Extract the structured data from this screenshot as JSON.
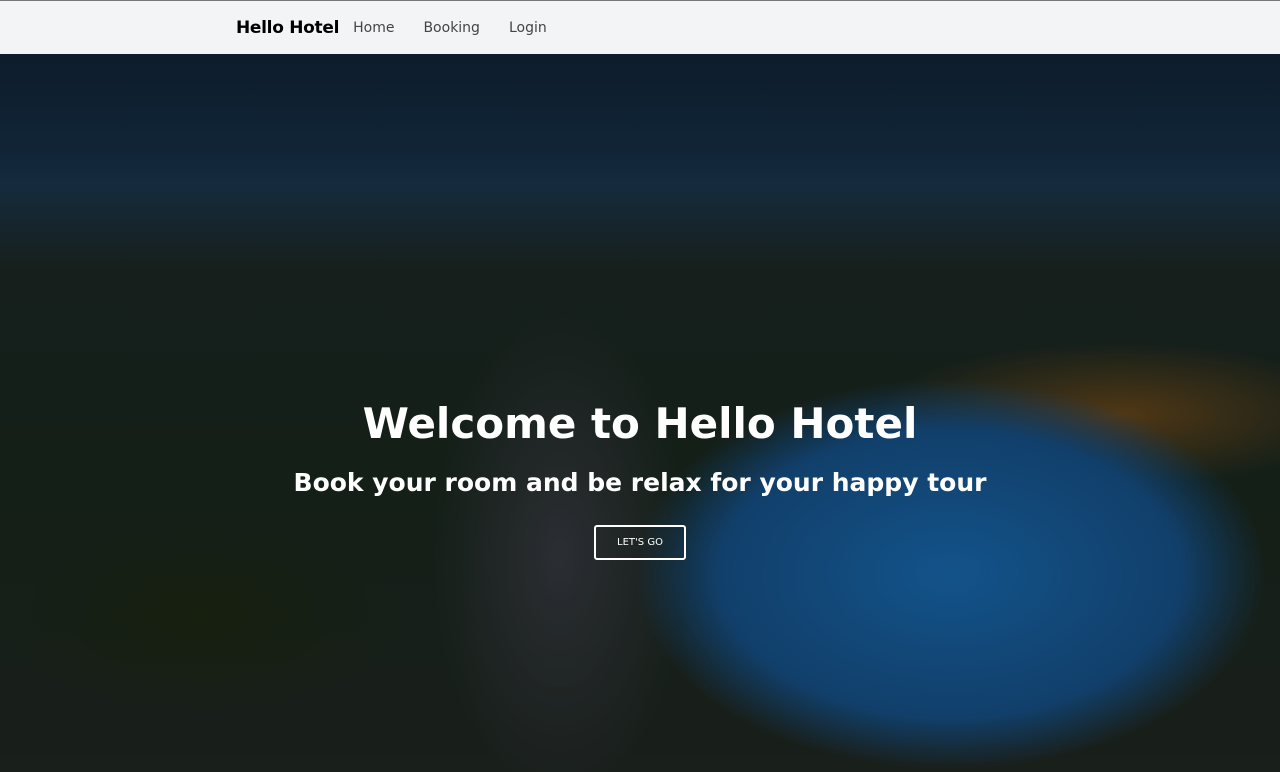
{
  "nav": {
    "brand": "Hello Hotel",
    "items": [
      {
        "label": "Home"
      },
      {
        "label": "Booking"
      },
      {
        "label": "Login"
      }
    ]
  },
  "hero": {
    "title": "Welcome to Hello Hotel",
    "subtitle": "Book your room and be relax for your happy tour",
    "cta_label": "LET'S GO"
  },
  "colors": {
    "nav_bg": "#f3f4f6",
    "cta_border": "#ffffff"
  }
}
